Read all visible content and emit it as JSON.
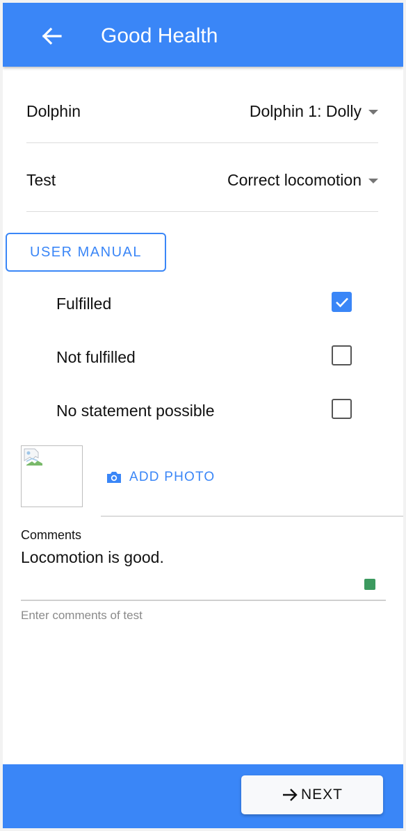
{
  "app_bar": {
    "back_icon": "arrow-left-icon",
    "title": "Good Health",
    "color": "#3a86f7"
  },
  "form": {
    "dolphin": {
      "label": "Dolphin",
      "value": "Dolphin 1: Dolly"
    },
    "test": {
      "label": "Test",
      "value": "Correct locomotion"
    }
  },
  "user_manual": {
    "label": "USER MANUAL"
  },
  "options": [
    {
      "label": "Fulfilled",
      "checked": true
    },
    {
      "label": "Not fulfilled",
      "checked": false
    },
    {
      "label": "No statement possible",
      "checked": false
    }
  ],
  "photo": {
    "thumbnail_icon": "broken-image-icon",
    "add_photo_icon": "camera-icon",
    "add_photo_label": "ADD PHOTO"
  },
  "comments": {
    "label": "Comments",
    "value": "Locomotion is good.",
    "hint": "Enter comments of test"
  },
  "footer": {
    "next_icon": "arrow-right-icon",
    "next_label": "NEXT"
  }
}
